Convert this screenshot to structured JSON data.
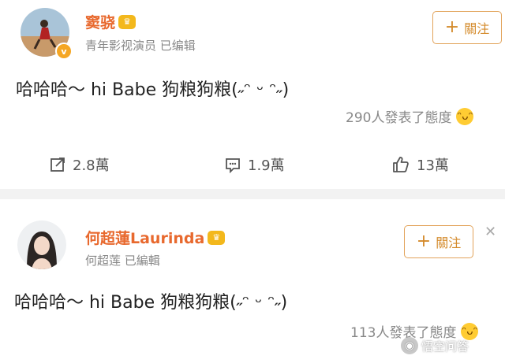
{
  "posts": [
    {
      "name": "窦骁",
      "subtitle": "青年影视演员 已编辑",
      "follow_label": "關注",
      "text": "哈哈哈～ hi Babe 狗粮狗粮(˶ᵔ ᵕ ᵔ˶)",
      "reactions": "290人發表了態度",
      "share_count": "2.8萬",
      "comment_count": "1.9萬",
      "like_count": "13萬"
    },
    {
      "name": "何超蓮Laurinda",
      "subtitle": "何超莲 已編輯",
      "follow_label": "關注",
      "text": "哈哈哈～ hi Babe 狗粮狗粮(˶ᵔ ᵕ ᵔ˶)",
      "reactions": "113人發表了態度"
    }
  ],
  "watermark": "悟空问答",
  "colors": {
    "accent": "#e8692e",
    "follow_border": "#e2a35a",
    "verified": "#f5a623"
  }
}
